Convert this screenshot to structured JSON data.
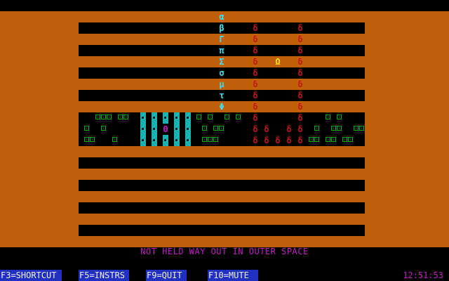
{
  "colors": {
    "background": "#000000",
    "field": "#c0600a",
    "stripe": "#000000",
    "cyan": "#3ee0ee",
    "red": "#c01818",
    "yellow": "#f6e020",
    "magenta": "#c020c0",
    "green": "#10a010",
    "menu_bg": "#2030c0"
  },
  "column_glyphs": [
    "α",
    "β",
    "Γ",
    "π",
    "Σ",
    "σ",
    "μ",
    "τ",
    "Φ"
  ],
  "enemy_glyph": "δ",
  "player_glyph": "Ω",
  "special_glyph": "Θ",
  "status_message": "NOT HELD WAY OUT IN OUTER SPACE",
  "function_keys": [
    {
      "key": "F3",
      "label": "F3=SHORTCUT"
    },
    {
      "key": "F5",
      "label": "F5=INSTRS"
    },
    {
      "key": "F9",
      "label": "F9=QUIT"
    },
    {
      "key": "F10",
      "label": "F10=MUTE"
    }
  ],
  "clock": "12:51:53"
}
